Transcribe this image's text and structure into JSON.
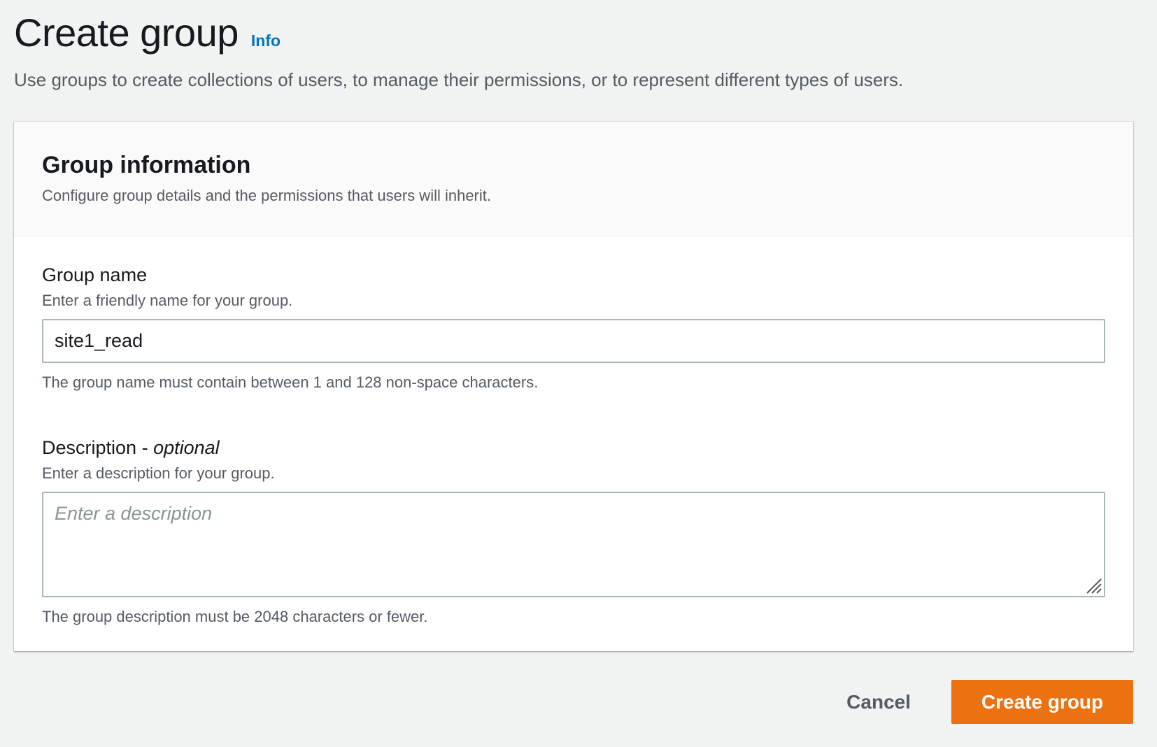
{
  "header": {
    "title": "Create group",
    "info_link": "Info",
    "description": "Use groups to create collections of users, to manage their permissions, or to represent different types of users."
  },
  "group_information": {
    "title": "Group information",
    "description": "Configure group details and the permissions that users will inherit."
  },
  "group_name": {
    "label": "Group name",
    "description": "Enter a friendly name for your group.",
    "value": "site1_read",
    "constraint": "The group name must contain between 1 and 128 non-space characters."
  },
  "description_field": {
    "label": "Description",
    "label_suffix": " - ",
    "optional_text": "optional",
    "description": "Enter a description for your group.",
    "placeholder": "Enter a description",
    "constraint": "The group description must be 2048 characters or fewer."
  },
  "actions": {
    "cancel_label": "Cancel",
    "create_label": "Create group"
  },
  "colors": {
    "primary_button": "#ec7211",
    "link": "#0073bb",
    "page_background": "#f1f2f2"
  }
}
